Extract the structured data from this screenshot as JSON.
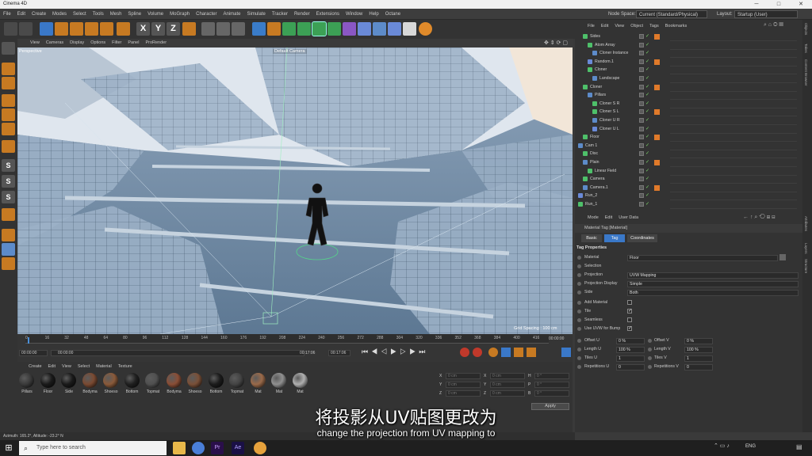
{
  "window": {
    "title": "Cinema 4D"
  },
  "menubar": {
    "items": [
      "File",
      "Edit",
      "Create",
      "Modes",
      "Select",
      "Tools",
      "Mesh",
      "Spline",
      "Volume",
      "MoGraph",
      "Character",
      "Animate",
      "Simulate",
      "Tracker",
      "Render",
      "Extensions",
      "Window",
      "Help",
      "Octane"
    ],
    "node_space_label": "Node Space:",
    "node_space_value": "Current (Standard/Physical)",
    "layout_label": "Layout:",
    "layout_value": "Startup (User)"
  },
  "toolbar": {
    "axis_x": "X",
    "axis_y": "Y",
    "axis_z": "Z"
  },
  "viewport": {
    "menu": [
      "View",
      "Cameras",
      "Display",
      "Options",
      "Filter",
      "Panel",
      "ProRender"
    ],
    "name": "Perspective",
    "camera_label": "Default Camera",
    "grid_spacing": "Grid Spacing : 100 cm"
  },
  "timeline": {
    "ticks": [
      "0",
      "16",
      "32",
      "48",
      "64",
      "80",
      "96",
      "112",
      "128",
      "144",
      "160",
      "176",
      "192",
      "208",
      "224",
      "240",
      "256",
      "272",
      "288",
      "304",
      "320",
      "336",
      "352",
      "368",
      "384",
      "400",
      "416"
    ],
    "end_frame": "00:00:00",
    "current_time": "00:00:00",
    "start_time": "00:00:00",
    "mid_time": "00:17:06",
    "end_time": "00:17:06"
  },
  "material_manager": {
    "menu": [
      "Create",
      "Edit",
      "View",
      "Select",
      "Material",
      "Texture"
    ],
    "materials": [
      {
        "label": "Pillars",
        "color": "#3b3b3b"
      },
      {
        "label": "Floor",
        "color": "#1a1a1a"
      },
      {
        "label": "Side",
        "color": "#1a1a1a"
      },
      {
        "label": "Bodyma",
        "color": "#7a4a32"
      },
      {
        "label": "Shoeso",
        "color": "#8a5a3a"
      },
      {
        "label": "Bottom",
        "color": "#202020"
      },
      {
        "label": "Topmat",
        "color": "#505050"
      },
      {
        "label": "Bodyma",
        "color": "#8a4e36"
      },
      {
        "label": "Shoeso",
        "color": "#7a5038"
      },
      {
        "label": "Bottom",
        "color": "#1c1c1c"
      },
      {
        "label": "Topmat",
        "color": "#444444"
      },
      {
        "label": "Mat",
        "color": "#9a6a4a"
      },
      {
        "label": "Mat",
        "color": "#909090"
      },
      {
        "label": "Mat",
        "color": "#b0b0b0"
      }
    ]
  },
  "coordinates": {
    "rows": [
      {
        "a": "X",
        "av": "0 cm",
        "b": "X",
        "bv": "0 cm",
        "c": "H",
        "cv": "0 °"
      },
      {
        "a": "Y",
        "av": "0 cm",
        "b": "Y",
        "bv": "0 cm",
        "c": "P",
        "cv": "0 °"
      },
      {
        "a": "Z",
        "av": "0 cm",
        "b": "Z",
        "bv": "0 cm",
        "c": "B",
        "cv": "0 °"
      }
    ],
    "apply_label": "Apply"
  },
  "object_manager": {
    "menu": [
      "File",
      "Edit",
      "View",
      "Object",
      "Tags",
      "Bookmarks"
    ],
    "objects": [
      {
        "name": "Sides",
        "indent": 1
      },
      {
        "name": "Atom Array",
        "indent": 2
      },
      {
        "name": "Cloner Instance",
        "indent": 3
      },
      {
        "name": "Random.1",
        "indent": 2
      },
      {
        "name": "Cloner",
        "indent": 2
      },
      {
        "name": "Landscape",
        "indent": 3
      },
      {
        "name": "Cloner",
        "indent": 1
      },
      {
        "name": "Pillars",
        "indent": 2
      },
      {
        "name": "Cloner S R",
        "indent": 3
      },
      {
        "name": "Cloner S L",
        "indent": 3
      },
      {
        "name": "Cloner U R",
        "indent": 3
      },
      {
        "name": "Cloner U L",
        "indent": 3
      },
      {
        "name": "Floor",
        "indent": 1
      },
      {
        "name": "Cam 1",
        "indent": 0
      },
      {
        "name": "Disc",
        "indent": 1
      },
      {
        "name": "Plain",
        "indent": 1
      },
      {
        "name": "Linear Field",
        "indent": 2
      },
      {
        "name": "Camera",
        "indent": 1
      },
      {
        "name": "Camera.1",
        "indent": 1
      },
      {
        "name": "Run_2",
        "indent": 0
      },
      {
        "name": "Run_1",
        "indent": 0
      }
    ]
  },
  "attributes": {
    "menu": [
      "Mode",
      "Edit",
      "User Data"
    ],
    "header": "Material Tag [Material]",
    "tabs": [
      "Basic",
      "Tag",
      "Coordinates"
    ],
    "active_tab": "Tag",
    "section": "Tag Properties",
    "props": [
      {
        "label": "Material",
        "value": "Floor"
      },
      {
        "label": "Selection",
        "value": ""
      },
      {
        "label": "Projection",
        "value": "UVW Mapping"
      },
      {
        "label": "Projection Display",
        "value": "Simple"
      },
      {
        "label": "Side",
        "value": "Both"
      }
    ],
    "checks": [
      {
        "label": "Add Material",
        "checked": false
      },
      {
        "label": "Tile",
        "checked": true
      },
      {
        "label": "Seamless",
        "checked": false
      },
      {
        "label": "Use UVW for Bump",
        "checked": true
      }
    ],
    "pairs": [
      {
        "l1": "Offset U",
        "v1": "0 %",
        "l2": "Offset V",
        "v2": "0 %"
      },
      {
        "l1": "Length U",
        "v1": "100 %",
        "l2": "Length V",
        "v2": "100 %"
      },
      {
        "l1": "Tiles U",
        "v1": "1",
        "l2": "Tiles V",
        "v2": "1"
      },
      {
        "l1": "Repetitions U",
        "v1": "0",
        "l2": "Repetitions V",
        "v2": "0"
      }
    ]
  },
  "right_tabs": [
    "Objects",
    "Takes",
    "Content Browser",
    "Attributes",
    "Layers",
    "Structure"
  ],
  "status": {
    "text": "Azimuth: 165.2°, Altitude: -23.2°  N"
  },
  "subtitles": {
    "cn": "将投影从UV贴图更改为",
    "en": "change the projection from UV mapping to"
  },
  "taskbar": {
    "search_placeholder": "Type here to search",
    "lang": "ENG",
    "apps": [
      "file-explorer",
      "chrome",
      "premiere",
      "after-effects",
      "chrome-alt"
    ]
  },
  "colors": {
    "accent": "#4a8fd8",
    "tab_active": "#3a78c8",
    "check": "#7ad36a"
  }
}
